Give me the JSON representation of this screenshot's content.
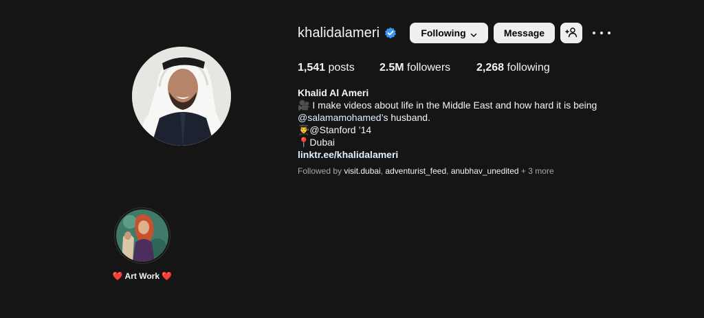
{
  "profile": {
    "username": "khalidalameri",
    "full_name": "Khalid Al Ameri",
    "verified": true
  },
  "actions": {
    "following_label": "Following",
    "message_label": "Message",
    "suggest_icon": "add-person-icon",
    "more_icon": "more-dots-icon"
  },
  "stats": {
    "posts_count": "1,541",
    "posts_label": " posts",
    "followers_count": "2.5M",
    "followers_label": " followers",
    "following_count": "2,268",
    "following_label": " following"
  },
  "bio": {
    "line1_prefix": "🎥 I make videos about life in the Middle East and how hard it is being ",
    "line1_mention": "@salamamohamed",
    "line1_suffix": "’s husband.",
    "line2": "👨‍🎓@Stanford ’14",
    "line3": "📍Dubai",
    "link": "linktr.ee/khalidalameri"
  },
  "followed_by": {
    "prefix": "Followed by ",
    "accounts": [
      "visit.dubai",
      "adventurist_feed",
      "anubhav_unedited"
    ],
    "separator": ", ",
    "more": " + 3 more"
  },
  "highlights": [
    {
      "label": "❤️ Art Work ❤️"
    }
  ],
  "colors": {
    "background": "#151515",
    "button_bg": "#efefef",
    "verified_blue": "#3897f0",
    "secondary_text": "#a8a8a8"
  }
}
